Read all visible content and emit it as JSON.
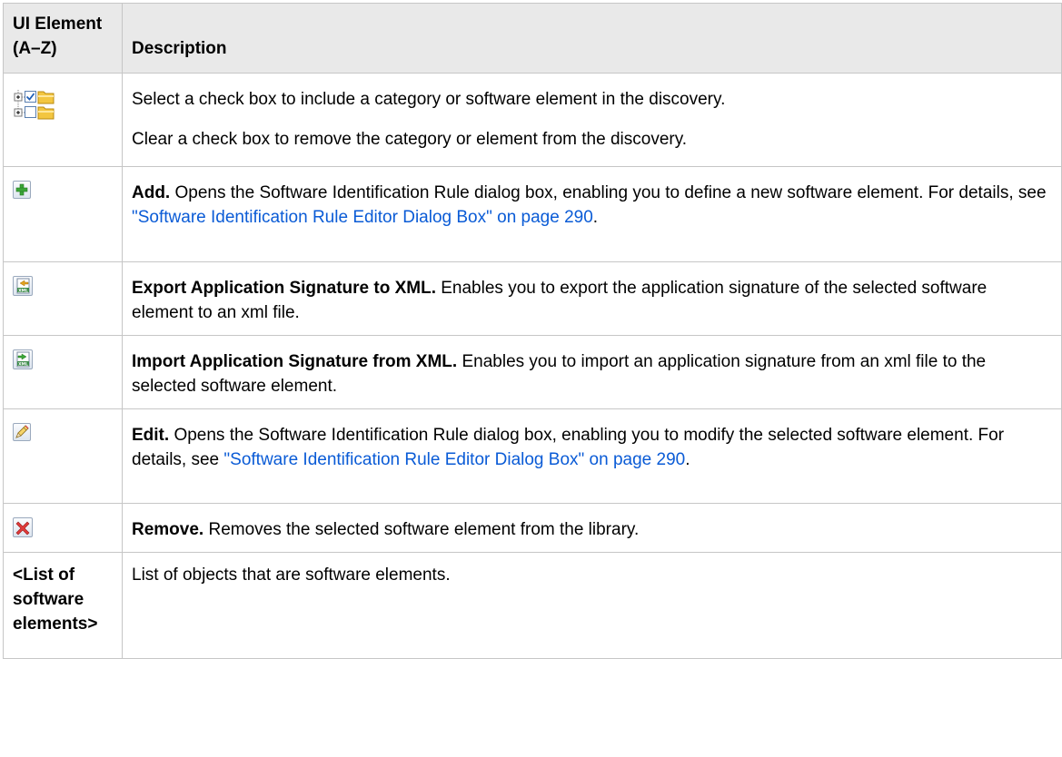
{
  "table": {
    "headers": {
      "element": "UI Element (A–Z)",
      "description": "Description"
    },
    "rows": [
      {
        "icon": "tree-checkbox-folder-icon",
        "desc_1": "Select a check box to include a category or software element in the discovery.",
        "desc_2": "Clear a check box to remove the category or element from the discovery."
      },
      {
        "icon": "add-icon",
        "term": "Add.",
        "text": " Opens the Software Identification Rule dialog box, enabling you to define a new software element. For details, see ",
        "link": "\"Software Identification Rule Editor Dialog Box\" on page 290",
        "end": "."
      },
      {
        "icon": "export-xml-icon",
        "term": "Export Application Signature to XML.",
        "text": " Enables you to export the application signature of the selected software element to an xml file."
      },
      {
        "icon": "import-xml-icon",
        "term": "Import Application Signature from XML.",
        "text": " Enables you to import an application signature from an xml file to the selected software element."
      },
      {
        "icon": "edit-pencil-icon",
        "term": "Edit.",
        "text": " Opens the Software Identification Rule dialog box, enabling you to modify the selected software element. For details, see ",
        "link": "\"Software Identification Rule Editor Dialog Box\" on page 290",
        "end": "."
      },
      {
        "icon": "remove-icon",
        "term": "Remove.",
        "text": " Removes the selected software element from the library."
      },
      {
        "element": "<List of software elements>",
        "text": "List of objects that are software elements."
      }
    ]
  },
  "colors": {
    "header_bg": "#e9e9e9",
    "border": "#c6c6c6",
    "link": "#0a5bd6"
  }
}
